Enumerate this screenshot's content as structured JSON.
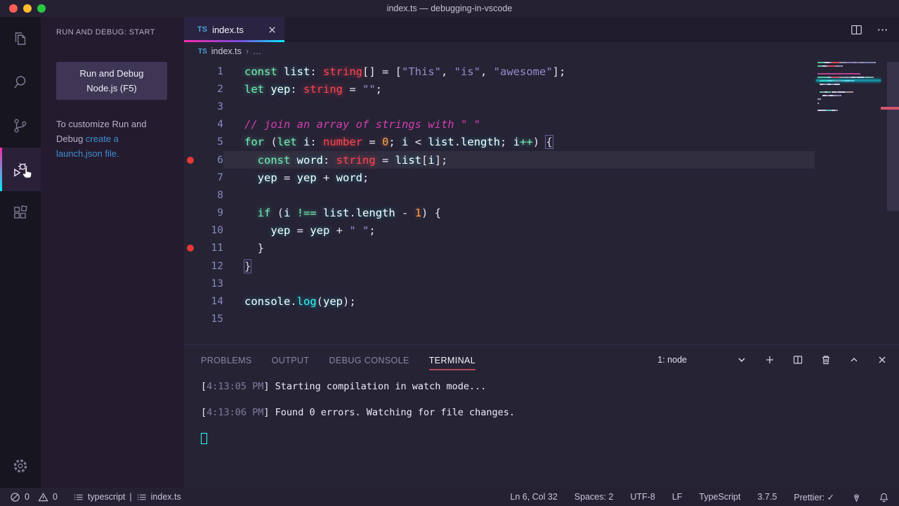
{
  "window": {
    "title": "index.ts — debugging-in-vscode"
  },
  "colors": {
    "bg_editor": "#262335",
    "bg_sidebar": "#241b2f",
    "bg_activity": "#171520",
    "bg_titlebar": "#262132",
    "bg_statusbar": "#262132",
    "bg_tabbar": "#201b2d",
    "bg_tab_active": "#2b2342",
    "accent_pink": "#f92aad",
    "accent_cyan": "#03edf9",
    "green": "#72f1b8",
    "type_pink": "#fe4450",
    "string": "#938ecb",
    "orange": "#ff9b50",
    "comment": "#d43fae",
    "cyan": "#36f9f6",
    "link": "#3e8fd0",
    "ts_blue": "#4aa0d8",
    "button_bg": "#3e3654",
    "breakpoint": "#e53935",
    "panel_underline": "#b04758",
    "traffic_red": "#ff5f57",
    "traffic_yellow": "#febc2e",
    "traffic_green": "#28c840"
  },
  "activity_bar": {
    "items": [
      {
        "name": "explorer",
        "active": false
      },
      {
        "name": "search",
        "active": false
      },
      {
        "name": "source-control",
        "active": false
      },
      {
        "name": "run-and-debug",
        "active": true
      },
      {
        "name": "extensions",
        "active": false
      }
    ],
    "bottom_items": [
      {
        "name": "settings",
        "active": false
      }
    ]
  },
  "sidebar": {
    "header": "RUN AND DEBUG: START",
    "button": {
      "line1": "Run and Debug",
      "line2": "Node.js (F5)"
    },
    "hint": {
      "prefix": "To customize Run and Debug ",
      "link": "create a launch.json file."
    }
  },
  "editor": {
    "tab": {
      "icon": "TS",
      "label": "index.ts"
    },
    "breadcrumb": {
      "icon": "TS",
      "file": "index.ts",
      "separator": "›",
      "symbol": "…"
    },
    "active_line": 6,
    "breakpoints": [
      6,
      11
    ],
    "lines": [
      {
        "n": 1,
        "tokens": [
          {
            "t": "const ",
            "c": "kw"
          },
          {
            "t": "list",
            "c": "var"
          },
          {
            "t": ": ",
            "c": "pun"
          },
          {
            "t": "string",
            "c": "type"
          },
          {
            "t": "[] = [",
            "c": "pun"
          },
          {
            "t": "\"This\"",
            "c": "str"
          },
          {
            "t": ", ",
            "c": "pun"
          },
          {
            "t": "\"is\"",
            "c": "str"
          },
          {
            "t": ", ",
            "c": "pun"
          },
          {
            "t": "\"awesome\"",
            "c": "str"
          },
          {
            "t": "];",
            "c": "pun"
          }
        ]
      },
      {
        "n": 2,
        "tokens": [
          {
            "t": "let ",
            "c": "kw"
          },
          {
            "t": "yep",
            "c": "var"
          },
          {
            "t": ": ",
            "c": "pun"
          },
          {
            "t": "string",
            "c": "type"
          },
          {
            "t": " = ",
            "c": "pun"
          },
          {
            "t": "\"\"",
            "c": "str"
          },
          {
            "t": ";",
            "c": "pun"
          }
        ]
      },
      {
        "n": 3,
        "tokens": []
      },
      {
        "n": 4,
        "tokens": [
          {
            "t": "// join an array of strings with \" \"",
            "c": "com"
          }
        ]
      },
      {
        "n": 5,
        "tokens": [
          {
            "t": "for ",
            "c": "kw"
          },
          {
            "t": "(",
            "c": "pun"
          },
          {
            "t": "let ",
            "c": "kw"
          },
          {
            "t": "i",
            "c": "var"
          },
          {
            "t": ": ",
            "c": "pun"
          },
          {
            "t": "number",
            "c": "type"
          },
          {
            "t": " = ",
            "c": "pun"
          },
          {
            "t": "0",
            "c": "num"
          },
          {
            "t": "; ",
            "c": "pun"
          },
          {
            "t": "i",
            "c": "var"
          },
          {
            "t": " < ",
            "c": "pun"
          },
          {
            "t": "list",
            "c": "var"
          },
          {
            "t": ".",
            "c": "pun"
          },
          {
            "t": "length",
            "c": "var"
          },
          {
            "t": "; ",
            "c": "pun"
          },
          {
            "t": "i",
            "c": "var"
          },
          {
            "t": "++",
            "c": "opg"
          },
          {
            "t": ") ",
            "c": "pun"
          },
          {
            "t": "{",
            "c": "brk"
          }
        ]
      },
      {
        "n": 6,
        "tokens": [
          {
            "t": "  ",
            "c": "pun"
          },
          {
            "t": "const ",
            "c": "kw"
          },
          {
            "t": "word",
            "c": "var"
          },
          {
            "t": ": ",
            "c": "pun"
          },
          {
            "t": "string",
            "c": "type"
          },
          {
            "t": " = ",
            "c": "pun"
          },
          {
            "t": "list",
            "c": "var"
          },
          {
            "t": "[",
            "c": "pun"
          },
          {
            "t": "i",
            "c": "var"
          },
          {
            "t": "];",
            "c": "pun"
          }
        ]
      },
      {
        "n": 7,
        "tokens": [
          {
            "t": "  ",
            "c": "pun"
          },
          {
            "t": "yep",
            "c": "var"
          },
          {
            "t": " = ",
            "c": "pun"
          },
          {
            "t": "yep",
            "c": "var"
          },
          {
            "t": " + ",
            "c": "pun"
          },
          {
            "t": "word",
            "c": "var"
          },
          {
            "t": ";",
            "c": "pun"
          }
        ]
      },
      {
        "n": 8,
        "tokens": []
      },
      {
        "n": 9,
        "tokens": [
          {
            "t": "  ",
            "c": "pun"
          },
          {
            "t": "if ",
            "c": "kw"
          },
          {
            "t": "(",
            "c": "pun"
          },
          {
            "t": "i ",
            "c": "var"
          },
          {
            "t": "!==",
            "c": "opg"
          },
          {
            "t": " ",
            "c": "pun"
          },
          {
            "t": "list",
            "c": "var"
          },
          {
            "t": ".",
            "c": "pun"
          },
          {
            "t": "length",
            "c": "var"
          },
          {
            "t": " - ",
            "c": "pun"
          },
          {
            "t": "1",
            "c": "num"
          },
          {
            "t": ") ",
            "c": "pun"
          },
          {
            "t": "{",
            "c": "pun"
          }
        ]
      },
      {
        "n": 10,
        "tokens": [
          {
            "t": "    ",
            "c": "pun"
          },
          {
            "t": "yep",
            "c": "var"
          },
          {
            "t": " = ",
            "c": "pun"
          },
          {
            "t": "yep",
            "c": "var"
          },
          {
            "t": " + ",
            "c": "pun"
          },
          {
            "t": "\" \"",
            "c": "str"
          },
          {
            "t": ";",
            "c": "pun"
          }
        ]
      },
      {
        "n": 11,
        "tokens": [
          {
            "t": "  }",
            "c": "pun"
          }
        ]
      },
      {
        "n": 12,
        "tokens": [
          {
            "t": "}",
            "c": "brk"
          }
        ]
      },
      {
        "n": 13,
        "tokens": []
      },
      {
        "n": 14,
        "tokens": [
          {
            "t": "console",
            "c": "var"
          },
          {
            "t": ".",
            "c": "pun"
          },
          {
            "t": "log",
            "c": "fn"
          },
          {
            "t": "(",
            "c": "pun"
          },
          {
            "t": "yep",
            "c": "var"
          },
          {
            "t": ");",
            "c": "pun"
          }
        ]
      },
      {
        "n": 15,
        "tokens": []
      }
    ]
  },
  "panel": {
    "tabs": [
      {
        "label": "PROBLEMS",
        "active": false
      },
      {
        "label": "OUTPUT",
        "active": false
      },
      {
        "label": "DEBUG CONSOLE",
        "active": false
      },
      {
        "label": "TERMINAL",
        "active": true
      }
    ],
    "terminal_picker": "1: node",
    "action_icons": [
      "chevron-down-icon",
      "plus-icon",
      "split-terminal-icon",
      "trash-icon",
      "chevron-up-icon",
      "close-icon"
    ]
  },
  "terminal": {
    "lines": [
      {
        "time": "4:13:05 PM",
        "text": "Starting compilation in watch mode..."
      },
      {
        "time": "",
        "text": ""
      },
      {
        "time": "4:13:06 PM",
        "text": "Found 0 errors. Watching for file changes."
      },
      {
        "time": "",
        "text": ""
      }
    ]
  },
  "status_bar": {
    "errors": "0",
    "warnings": "0",
    "watchers": [
      {
        "label": "typescript"
      },
      {
        "label": "index.ts"
      }
    ],
    "watcher_separator": "|",
    "right_items": [
      "Ln 6, Col 32",
      "Spaces: 2",
      "UTF-8",
      "LF",
      "TypeScript",
      "3.7.5",
      "Prettier: ✓"
    ],
    "right_icons": [
      "feedback-icon",
      "bell-icon"
    ]
  }
}
